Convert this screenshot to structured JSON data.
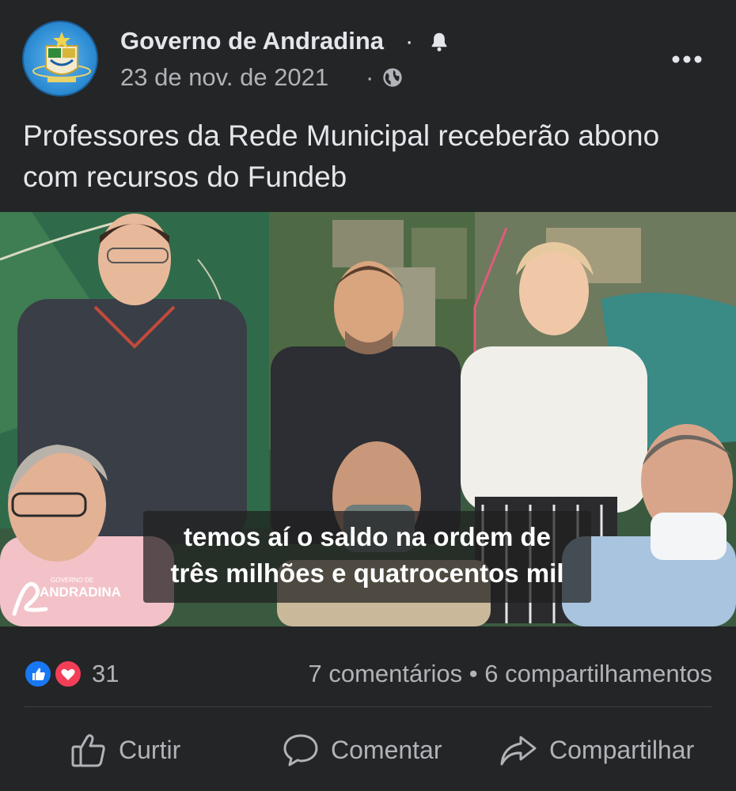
{
  "header": {
    "page_name": "Governo de Andradina",
    "name_separator": "·",
    "date": "23 de nov. de 2021",
    "date_separator": "·",
    "icons": {
      "notification": "bell-icon",
      "audience": "globe-icon",
      "more": "more-options-icon"
    }
  },
  "post": {
    "text": "Professores da Rede Municipal receberão abono com recursos do Fundeb"
  },
  "video": {
    "caption_line1": "temos aí o saldo na ordem de",
    "caption_line2": "três milhões e quatrocentos mil",
    "watermark_small": "GOVERNO DE",
    "watermark": "ANDRADINA"
  },
  "stats": {
    "reaction_count": "31",
    "engagement": "7 comentários • 6 compartilhamentos",
    "reaction_icons": [
      "like-icon",
      "love-icon"
    ]
  },
  "actions": {
    "like": "Curtir",
    "comment": "Comentar",
    "share": "Compartilhar"
  },
  "colors": {
    "background": "#242526",
    "text_primary": "#e4e6eb",
    "text_secondary": "#b0b3b8",
    "like_blue": "#1877f2",
    "love_red": "#f33e58"
  }
}
